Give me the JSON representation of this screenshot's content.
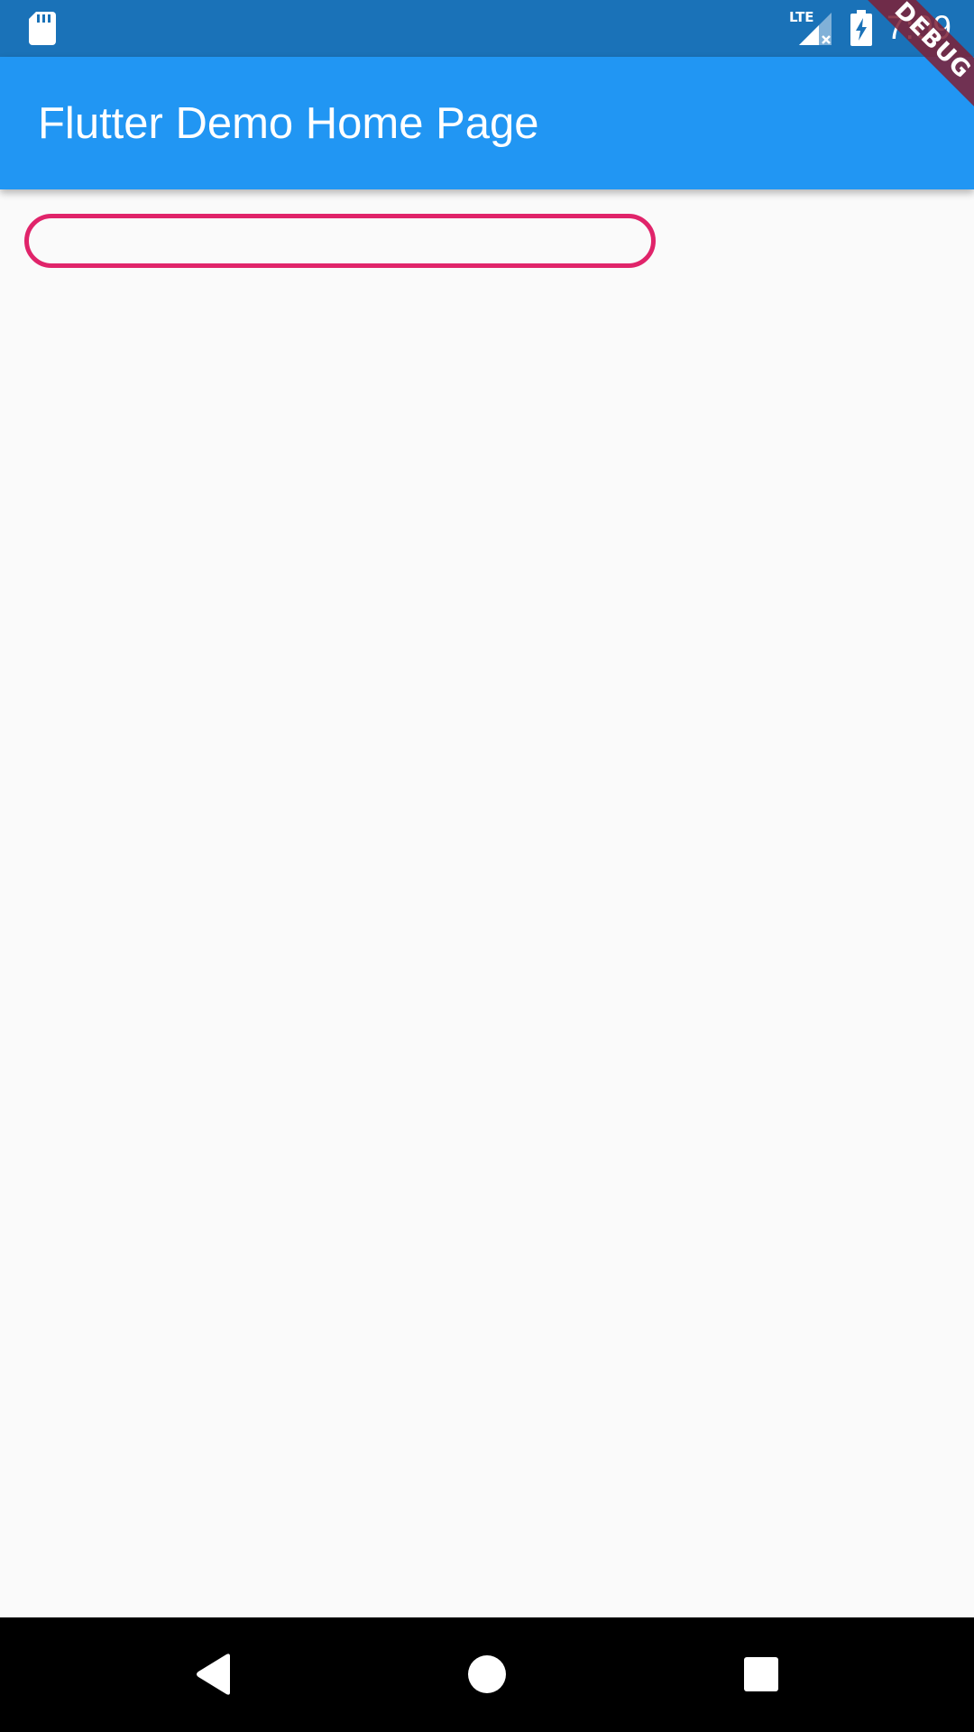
{
  "status_bar": {
    "time": "7:09",
    "network_label": "LTE",
    "icons": [
      "sd-card-icon",
      "lte-signal-icon",
      "battery-charging-icon"
    ],
    "background_color": "#1a72b8"
  },
  "app_bar": {
    "title": "Flutter Demo Home Page",
    "background_color": "#2196f3"
  },
  "debug_banner": {
    "label": "DEBUG",
    "color": "#7e2137"
  },
  "text_field": {
    "value": "",
    "placeholder": "",
    "border_color": "#e0246a",
    "focused": true
  },
  "nav_bar": {
    "buttons": [
      {
        "name": "back",
        "icon": "back-triangle-icon"
      },
      {
        "name": "home",
        "icon": "home-circle-icon"
      },
      {
        "name": "recents",
        "icon": "recents-square-icon"
      }
    ],
    "background_color": "#000000"
  }
}
